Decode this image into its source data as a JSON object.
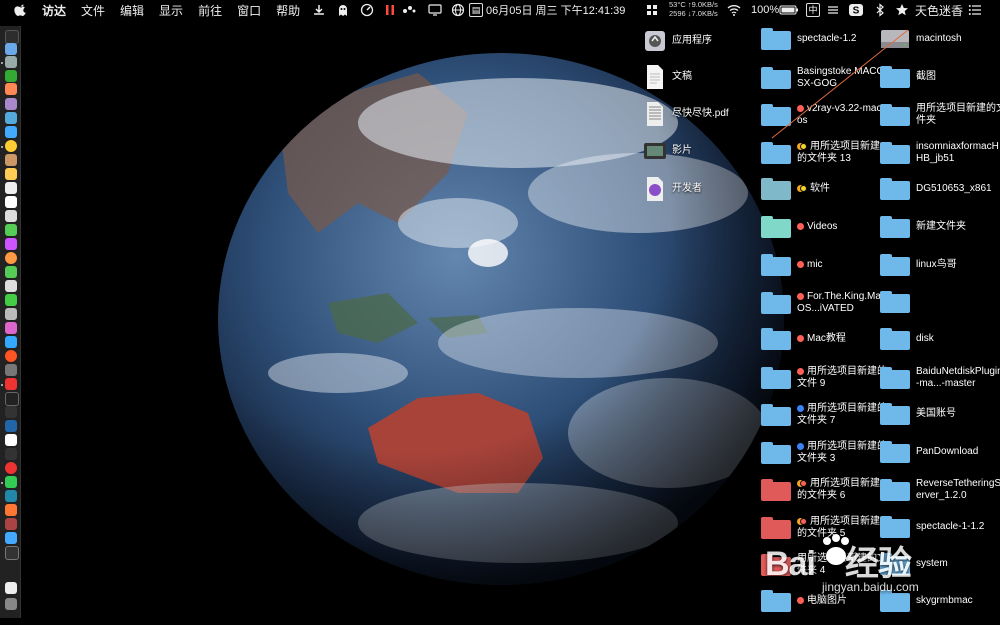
{
  "menubar": {
    "apple_icon": "apple-icon",
    "items": [
      "访达",
      "文件",
      "编辑",
      "显示",
      "前往",
      "窗口",
      "帮助"
    ],
    "datetime": "06月05日 周三 下午12:41:39",
    "net_temp": "53°C",
    "net_up": "↑9.0KB/s",
    "net_rpm": "2596",
    "net_down": "↓7.0KB/s",
    "battery": "100%",
    "input_method": "中",
    "user": "天色迷香"
  },
  "desktop": {
    "left_column": [
      {
        "label": "应用程序",
        "icon": "applications-icon"
      },
      {
        "label": "文稿",
        "icon": "document-icon"
      },
      {
        "label": "尽快尽快.pdf",
        "icon": "pdf-icon"
      },
      {
        "label": "影片",
        "icon": "movies-icon"
      },
      {
        "label": "开发者",
        "icon": "developer-icon"
      }
    ],
    "middle_column": [
      {
        "label": "spectacle-1.2",
        "tags": []
      },
      {
        "label": "Basingstoke.MACOSX-GOG",
        "tags": []
      },
      {
        "label": "v2ray-v3.22-macos",
        "tags": [
          "#ff5f57"
        ]
      },
      {
        "label": "用所选项目新建的文件夹 13",
        "tags": [
          "#f5a623",
          "#f5d423"
        ]
      },
      {
        "label": "软件",
        "tags": [
          "#f5a623",
          "#f5d423"
        ]
      },
      {
        "label": "Videos",
        "tags": [
          "#ff5f57"
        ]
      },
      {
        "label": "mic",
        "tags": [
          "#ff5f57"
        ]
      },
      {
        "label": "For.The.King.MacOS...iVATED",
        "tags": [
          "#ff5f57"
        ]
      },
      {
        "label": "Mac教程",
        "tags": [
          "#ff5f57"
        ]
      },
      {
        "label": "用所选项目新建的文件 9",
        "tags": [
          "#ff5f57"
        ]
      },
      {
        "label": "用所选项目新建的文件夹 7",
        "tags": [
          "#3b82f6"
        ]
      },
      {
        "label": "用所选项目新建的文件夹 3",
        "tags": [
          "#3b82f6"
        ]
      },
      {
        "label": "用所选项目新建的文件夹 6",
        "tags": [
          "#f5a623",
          "#ff5f57"
        ]
      },
      {
        "label": "用所选项目新建的文件夹 5",
        "tags": [
          "#f5a623",
          "#ff5f57"
        ]
      },
      {
        "label": "用所选项目新建的文件夹 4",
        "tags": []
      },
      {
        "label": "电脑图片",
        "tags": [
          "#ff5f57"
        ]
      }
    ],
    "right_column": [
      {
        "label": "macintosh"
      },
      {
        "label": "截图"
      },
      {
        "label": "用所选项目新建的文件夹"
      },
      {
        "label": "insomniaxformacHHB_jb51"
      },
      {
        "label": "DG510653_x861"
      },
      {
        "label": "新建文件夹"
      },
      {
        "label": "linux鸟哥"
      },
      {
        "label": ""
      },
      {
        "label": "disk"
      },
      {
        "label": "BaiduNetdiskPlugin-ma...-master"
      },
      {
        "label": "美国账号"
      },
      {
        "label": "PanDownload"
      },
      {
        "label": "ReverseTetheringServer_1.2.0"
      },
      {
        "label": "spectacle-1-1.2"
      },
      {
        "label": "system"
      },
      {
        "label": "skygrmbmac"
      }
    ]
  },
  "watermark": {
    "brand": "Bai",
    "brand2": "经验",
    "url": "jingyan.baidu.com"
  },
  "colors": {
    "folder_blue": "#6fb8ea",
    "folder_red": "#e05a5a",
    "menubar": "#000000"
  }
}
